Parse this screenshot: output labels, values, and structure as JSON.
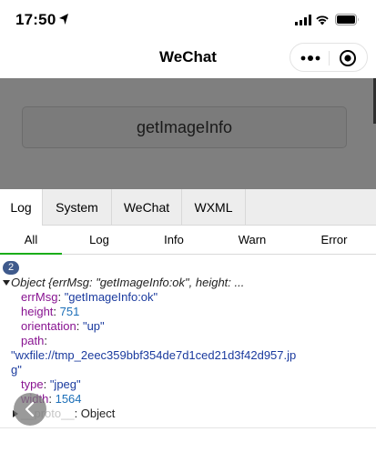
{
  "status_bar": {
    "time": "17:50"
  },
  "nav": {
    "title": "WeChat"
  },
  "page": {
    "button_label": "getImageInfo"
  },
  "console": {
    "tabs": [
      "Log",
      "System",
      "WeChat",
      "WXML"
    ],
    "active_tab": "Log",
    "filters": [
      "All",
      "Log",
      "Info",
      "Warn",
      "Error"
    ],
    "active_filter": "All",
    "log_count": "2",
    "object_summary": "Object {errMsg: \"getImageInfo:ok\", height: ...",
    "entries": {
      "errMsg_key": "errMsg",
      "errMsg_val": "\"getImageInfo:ok\"",
      "height_key": "height",
      "height_val": "751",
      "orientation_key": "orientation",
      "orientation_val": "\"up\"",
      "path_key": "path",
      "path_val_line1": "\"wxfile://tmp_2eec359bbf354de7d1ced21d3f42d957.jp",
      "path_val_line2": "g\"",
      "type_key": "type",
      "type_val": "\"jpeg\"",
      "width_key": "width",
      "width_val": "1564",
      "proto_key": "__proto__",
      "proto_val": "Object"
    }
  },
  "colors": {
    "accent_green": "#1aad19",
    "badge_blue": "#3f5a8c",
    "overlay_grey": "#7f7f7f"
  }
}
